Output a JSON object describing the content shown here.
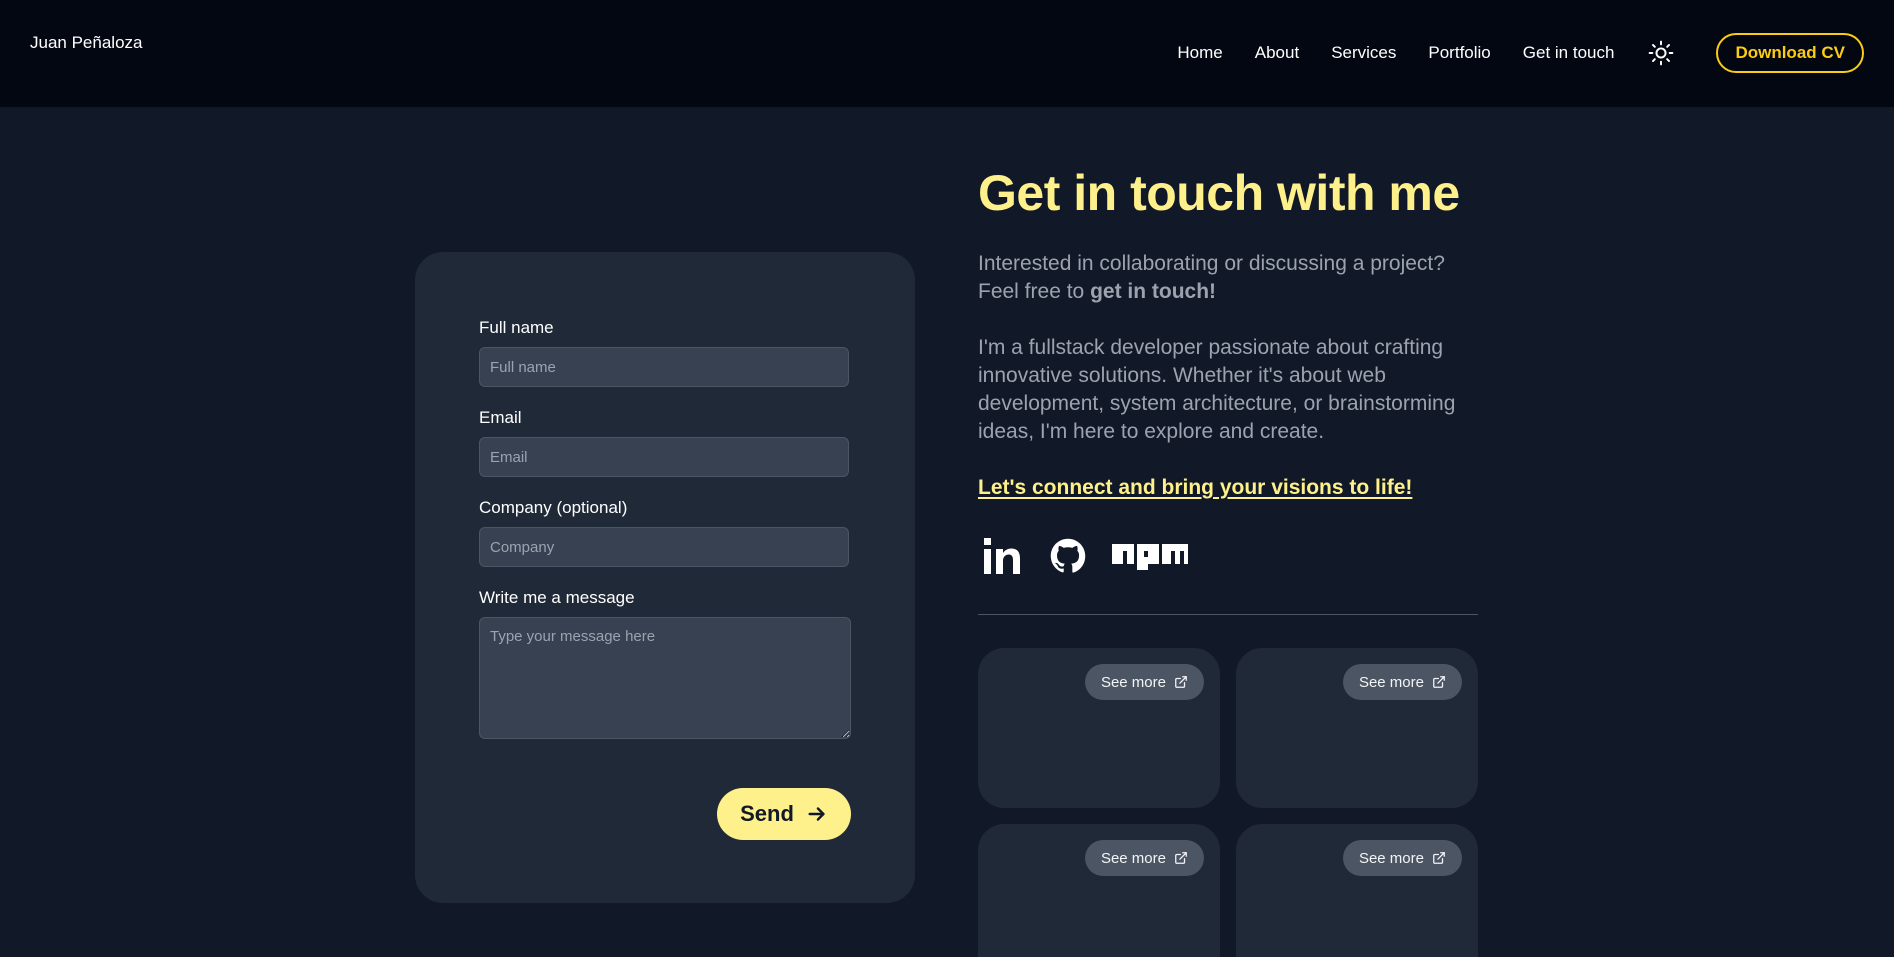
{
  "header": {
    "brand": "Juan Peñaloza",
    "nav": [
      "Home",
      "About",
      "Services",
      "Portfolio",
      "Get in touch"
    ],
    "theme_toggle_icon": "sun-icon",
    "download_cv": "Download CV"
  },
  "form": {
    "full_name_label": "Full name",
    "full_name_placeholder": "Full name",
    "email_label": "Email",
    "email_placeholder": "Email",
    "company_label": "Company (optional)",
    "company_placeholder": "Company",
    "message_label": "Write me a message",
    "message_placeholder": "Type your message here",
    "send_label": "Send",
    "send_icon": "arrow-right-icon"
  },
  "contact": {
    "heading": "Get in touch with me",
    "intro_line1": "Interested in collaborating or discussing a project?",
    "intro_line2_prefix": "Feel free to ",
    "intro_line2_bold": "get in touch!",
    "bio": "I'm a fullstack developer passionate about crafting innovative solutions. Whether it's about web development, system architecture, or brainstorming ideas, I'm here to explore and create.",
    "cta": "Let's connect and bring your visions to life!",
    "socials": [
      "linkedin-icon",
      "github-icon",
      "npm-icon"
    ]
  },
  "cards": [
    {
      "see_more": "See more",
      "icon": "external-link-icon"
    },
    {
      "see_more": "See more",
      "icon": "external-link-icon"
    },
    {
      "see_more": "See more",
      "icon": "external-link-icon"
    },
    {
      "see_more": "See more",
      "icon": "external-link-icon"
    }
  ],
  "colors": {
    "accent": "#fef08a",
    "cv_accent": "#facc15",
    "background": "#111827",
    "header": "#030712",
    "card": "#1f2937"
  }
}
